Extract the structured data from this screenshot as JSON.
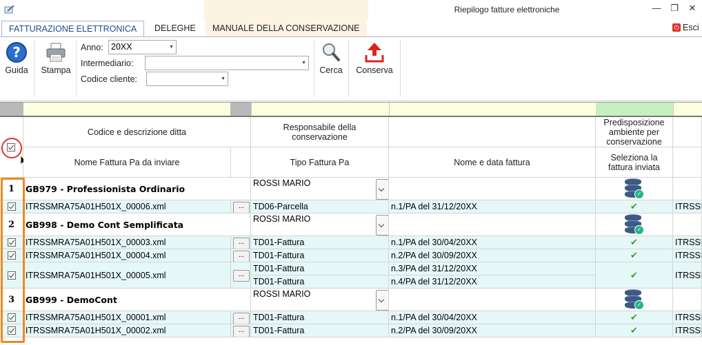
{
  "window": {
    "title": "Riepilogo fatture elettroniche",
    "controls": {
      "minimize": "—",
      "restore": "❐",
      "close": "✕"
    }
  },
  "tabs": [
    {
      "label": "FATTURAZIONE ELETTRONICA",
      "active": true
    },
    {
      "label": "DELEGHE",
      "active": false
    },
    {
      "label": "MANUALE DELLA CONSERVAZIONE",
      "active": false
    }
  ],
  "exit_label": "Esci",
  "ribbon": {
    "guida": "Guida",
    "stampa": "Stampa",
    "anno_label": "Anno:",
    "anno_value": "20XX",
    "intermediario_label": "Intermediario:",
    "intermediario_value": "",
    "codice_cliente_label": "Codice cliente:",
    "codice_cliente_value": "",
    "cerca": "Cerca",
    "conserva": "Conserva"
  },
  "colors": {
    "accent_orange": "#f08a1c",
    "highlight_cyan": "#e6f7f8",
    "header_yellow": "#ffffe0",
    "header_green": "#c6f0c0",
    "tick_green": "#3a9d23"
  },
  "headers": {
    "codice_descrizione": "Codice e descrizione ditta",
    "nome_fattura": "Nome Fattura Pa da inviare",
    "responsabile": "Responsabile della conservazione",
    "tipo_fattura": "Tipo Fattura Pa",
    "nome_data_fattura": "Nome e data fattura",
    "predisposizione": "Predisposizione ambiente per conservazione",
    "seleziona": "Seleziona la fattura inviata"
  },
  "groups": [
    {
      "num": "1",
      "ditta": "GB979 - Professionista Ordinario",
      "responsabile": "ROSSI MARIO",
      "rows": [
        {
          "file": "ITRSSMRA75A01H501X_00006.xml",
          "dots": "...",
          "invoices": [
            {
              "tipo": "TD06-Parcella",
              "nome": "n.1/PA del 31/12/20XX"
            }
          ],
          "last": "ITRSSM"
        }
      ]
    },
    {
      "num": "2",
      "ditta": "GB998 - Demo Cont Semplificata",
      "responsabile": "ROSSI MARIO",
      "rows": [
        {
          "file": "ITRSSMRA75A01H501X_00003.xml",
          "dots": "...",
          "invoices": [
            {
              "tipo": "TD01-Fattura",
              "nome": "n.1/PA del 30/04/20XX"
            }
          ],
          "last": "ITRSSM"
        },
        {
          "file": "ITRSSMRA75A01H501X_00004.xml",
          "dots": "...",
          "invoices": [
            {
              "tipo": "TD01-Fattura",
              "nome": "n.2/PA del 30/09/20XX"
            }
          ],
          "last": "ITRSSM"
        },
        {
          "file": "ITRSSMRA75A01H501X_00005.xml",
          "dots": "...",
          "invoices": [
            {
              "tipo": "TD01-Fattura",
              "nome": "n.3/PA del 31/12/20XX"
            },
            {
              "tipo": "TD01-Fattura",
              "nome": "n.4/PA del 31/12/20XX"
            }
          ],
          "last": "ITRSSM"
        }
      ]
    },
    {
      "num": "3",
      "ditta": "GB999 - DemoCont",
      "responsabile": "ROSSI MARIO",
      "rows": [
        {
          "file": "ITRSSMRA75A01H501X_00001.xml",
          "dots": "...",
          "invoices": [
            {
              "tipo": "TD01-Fattura",
              "nome": "n.1/PA del 30/04/20XX"
            }
          ],
          "last": "ITRSSM"
        },
        {
          "file": "ITRSSMRA75A01H501X_00002.xml",
          "dots": "...",
          "invoices": [
            {
              "tipo": "TD01-Fattura",
              "nome": "n.2/PA del 30/09/20XX"
            }
          ],
          "last": "ITRSSM"
        }
      ]
    }
  ]
}
